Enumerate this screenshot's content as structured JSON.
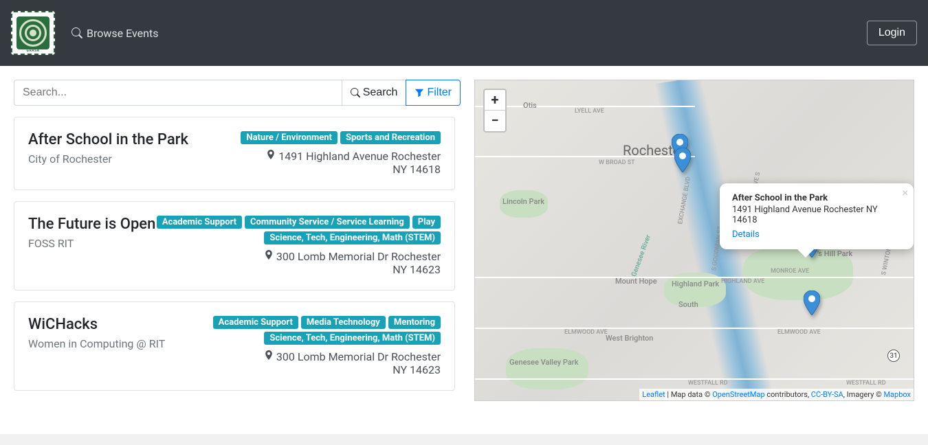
{
  "nav": {
    "browse_label": "Browse Events",
    "login_label": "Login",
    "logo_text": "GRASA"
  },
  "search": {
    "placeholder": "Search...",
    "search_label": "Search",
    "filter_label": "Filter"
  },
  "events": [
    {
      "title": "After School in the Park",
      "org": "City of Rochester",
      "tags": [
        "Nature / Environment",
        "Sports and Recreation"
      ],
      "address_line1": "1491 Highland Avenue Rochester",
      "address_line2": "NY 14618"
    },
    {
      "title": "The Future is Open",
      "org": "FOSS RIT",
      "tags": [
        "Academic Support",
        "Community Service / Service Learning",
        "Play",
        "Science, Tech, Engineering, Math (STEM)"
      ],
      "address_line1": "300 Lomb Memorial Dr Rochester",
      "address_line2": "NY 14623"
    },
    {
      "title": "WiCHacks",
      "org": "Women in Computing @ RIT",
      "tags": [
        "Academic Support",
        "Media Technology",
        "Mentoring",
        "Science, Tech, Engineering, Math (STEM)"
      ],
      "address_line1": "300 Lomb Memorial Dr Rochester",
      "address_line2": "NY 14623"
    }
  ],
  "map": {
    "zoom_in": "+",
    "zoom_out": "−",
    "city_label": "Rochester",
    "labels": {
      "otis": "Otis",
      "lyell": "LYELL AVE",
      "broad": "W BROAD ST",
      "lincoln": "Lincoln Park",
      "exchange": "EXCHANGE BLVD",
      "genesee": "Genesee River",
      "cobbs": "'s Hill Park",
      "clinton": "CLINTON AVE S",
      "goodman": "S GOODMAN ST",
      "monroe": "MONROE AVE",
      "winton": "S WINTON",
      "elmwood": "ELMWOOD AVE",
      "elmwood2": "ELMWOOD AVE",
      "westfall": "WESTFALL RD",
      "westfall2": "WESTFALL RD",
      "mthope": "Mount Hope",
      "highland": "Highland Park",
      "highland_ave": "HIGHLAND AVE",
      "brighton": "West Brighton",
      "south": "South",
      "gvp": "Genesee Valley Park",
      "route": "31"
    },
    "popup": {
      "title": "After School in the Park",
      "address": "1491 Highland Avenue Rochester NY 14618",
      "details_label": "Details"
    },
    "attribution": {
      "leaflet": "Leaflet",
      "sep1": " | Map data © ",
      "osm": "OpenStreetMap",
      "sep2": " contributors, ",
      "ccbysa": "CC-BY-SA",
      "sep3": ", Imagery © ",
      "mapbox": "Mapbox"
    }
  }
}
